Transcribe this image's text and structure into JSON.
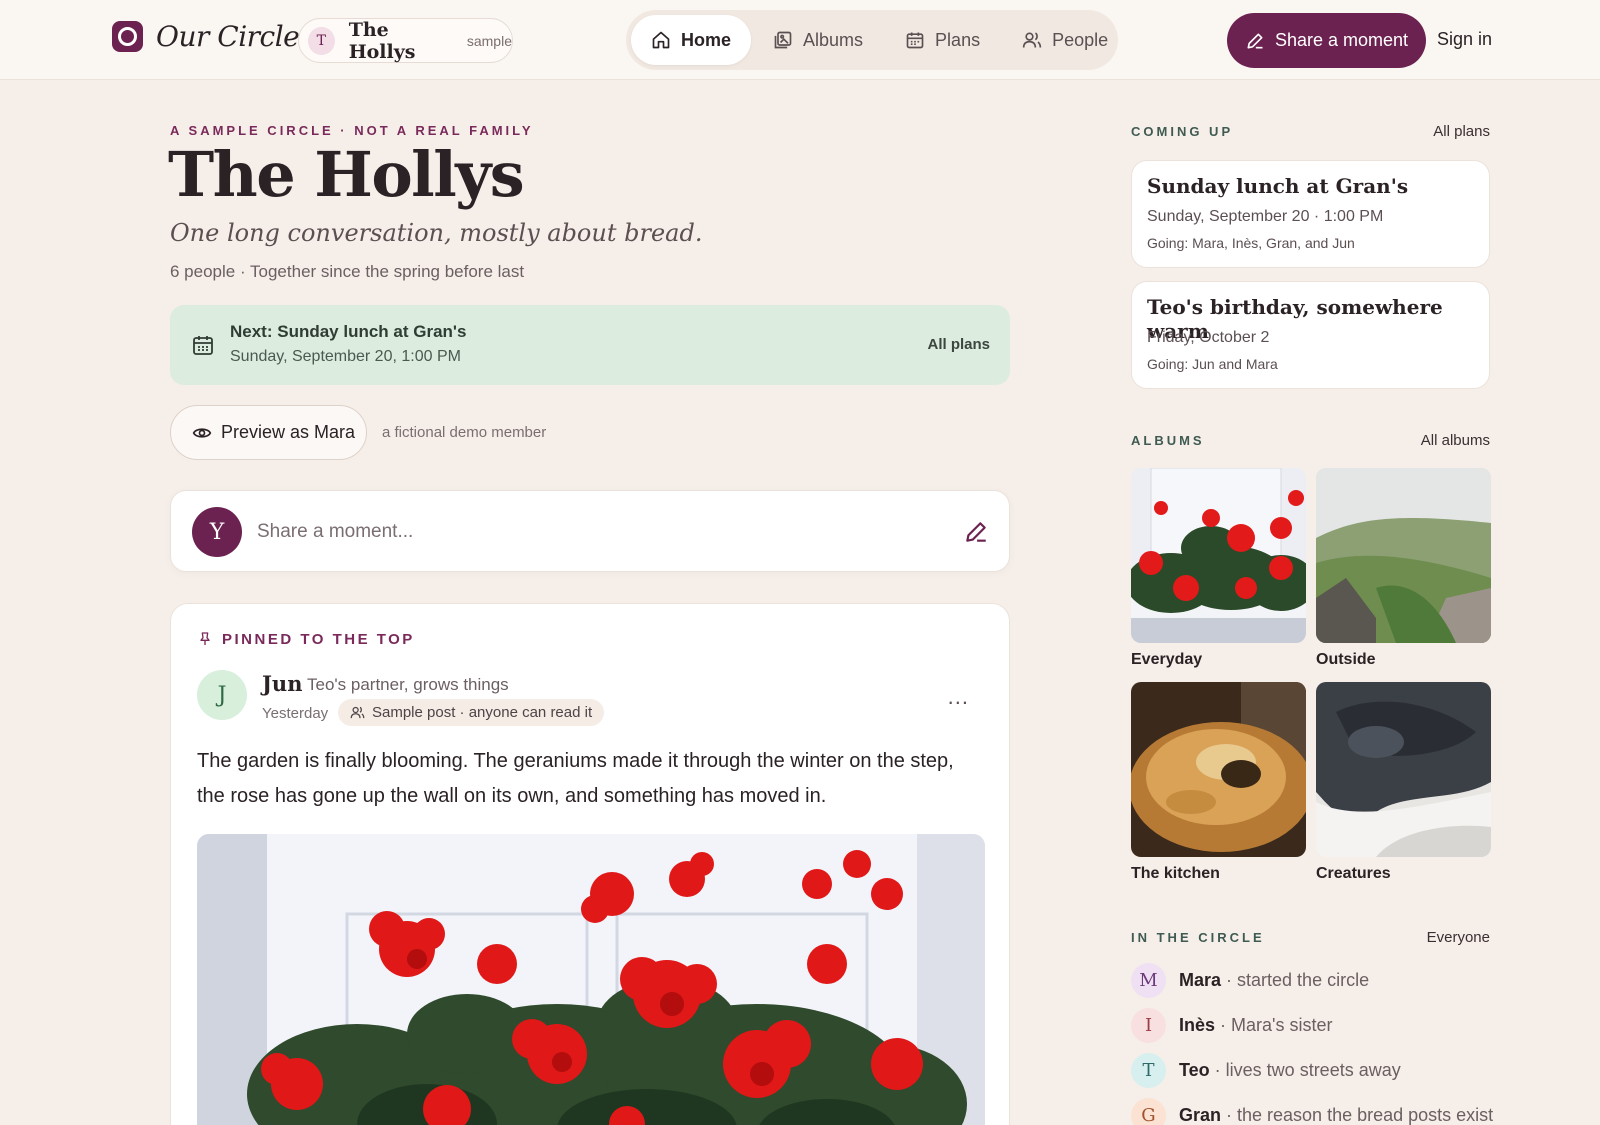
{
  "app": {
    "brand": "Our Circle",
    "circle_chip": {
      "initial": "T",
      "name": "The Hollys",
      "tag": "sample"
    }
  },
  "nav": {
    "items": [
      {
        "label": "Home",
        "icon": "home-icon",
        "active": true
      },
      {
        "label": "Albums",
        "icon": "album-icon",
        "active": false
      },
      {
        "label": "Plans",
        "icon": "calendar-icon",
        "active": false
      },
      {
        "label": "People",
        "icon": "people-icon",
        "active": false
      }
    ],
    "share_label": "Share a moment",
    "signin_label": "Sign in"
  },
  "hero": {
    "eyebrow": "A SAMPLE CIRCLE · NOT A REAL FAMILY",
    "title": "The Hollys",
    "tagline": "One long conversation, mostly about bread.",
    "meta": "6 people · Together since the spring before last"
  },
  "next_plan": {
    "title": "Next: Sunday lunch at Gran's",
    "when": "Sunday, September 20, 1:00 PM",
    "link": "All plans"
  },
  "preview": {
    "button_label": "Preview as Mara",
    "note": "a fictional demo member"
  },
  "composer": {
    "avatar_initial": "Y",
    "placeholder": "Share a moment..."
  },
  "pinned_post": {
    "pinned_label": "PINNED TO THE TOP",
    "author_initial": "J",
    "author": "Jun",
    "author_role": "Teo's partner, grows things",
    "time": "Yesterday",
    "badge": "Sample post · anyone can read it",
    "more": "...",
    "body": "The garden is finally blooming. The geraniums made it through the winter on the step, the rose has gone up the wall on its own, and something has moved in."
  },
  "sidebar": {
    "coming_up": {
      "heading": "COMING UP",
      "link": "All plans",
      "plans": [
        {
          "title": "Sunday lunch at Gran's",
          "date": "Sunday, September 20 · 1:00 PM",
          "going": "Going: Mara, Inès, Gran, and Jun"
        },
        {
          "title": "Teo's birthday, somewhere warm",
          "date": "Friday, October 2",
          "going": "Going: Jun and Mara"
        }
      ]
    },
    "albums": {
      "heading": "ALBUMS",
      "link": "All albums",
      "items": [
        {
          "name": "Everyday"
        },
        {
          "name": "Outside"
        },
        {
          "name": "The kitchen"
        },
        {
          "name": "Creatures"
        }
      ]
    },
    "circle": {
      "heading": "IN THE CIRCLE",
      "link": "Everyone",
      "members": [
        {
          "initial": "M",
          "name": "Mara",
          "desc": "· started the circle",
          "bg": "#efe1f3",
          "fg": "#6c3b7a"
        },
        {
          "initial": "I",
          "name": "Inès",
          "desc": "· Mara's sister",
          "bg": "#f8dfe0",
          "fg": "#9b3c46"
        },
        {
          "initial": "T",
          "name": "Teo",
          "desc": "· lives two streets away",
          "bg": "#d7efee",
          "fg": "#2f6a68"
        },
        {
          "initial": "G",
          "name": "Gran",
          "desc": "· the reason the bread posts exist",
          "bg": "#fbe2d2",
          "fg": "#a0522d"
        }
      ]
    }
  },
  "colors": {
    "brand": "#6c2250",
    "page_bg": "#f6efe9",
    "next_card_bg": "#dcecde"
  }
}
